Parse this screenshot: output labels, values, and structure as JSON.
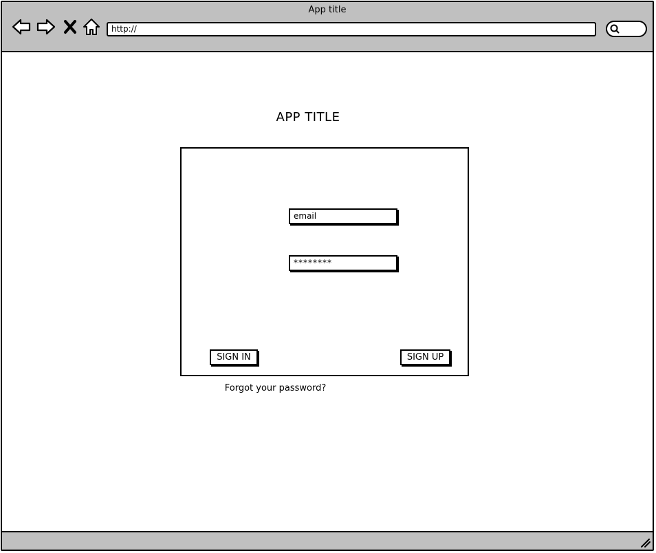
{
  "browser": {
    "window_title": "App title",
    "url": "http://"
  },
  "icons": {
    "back": "arrow-left-icon",
    "forward": "arrow-right-icon",
    "stop": "close-icon",
    "home": "home-icon",
    "search": "search-icon",
    "resize": "resize-grip-icon"
  },
  "app": {
    "title": "APP TITLE"
  },
  "login": {
    "email_value": "email",
    "password_value": "********",
    "sign_in_label": "SIGN IN",
    "sign_up_label": "SIGN UP",
    "forgot_link": "Forgot your password?"
  }
}
